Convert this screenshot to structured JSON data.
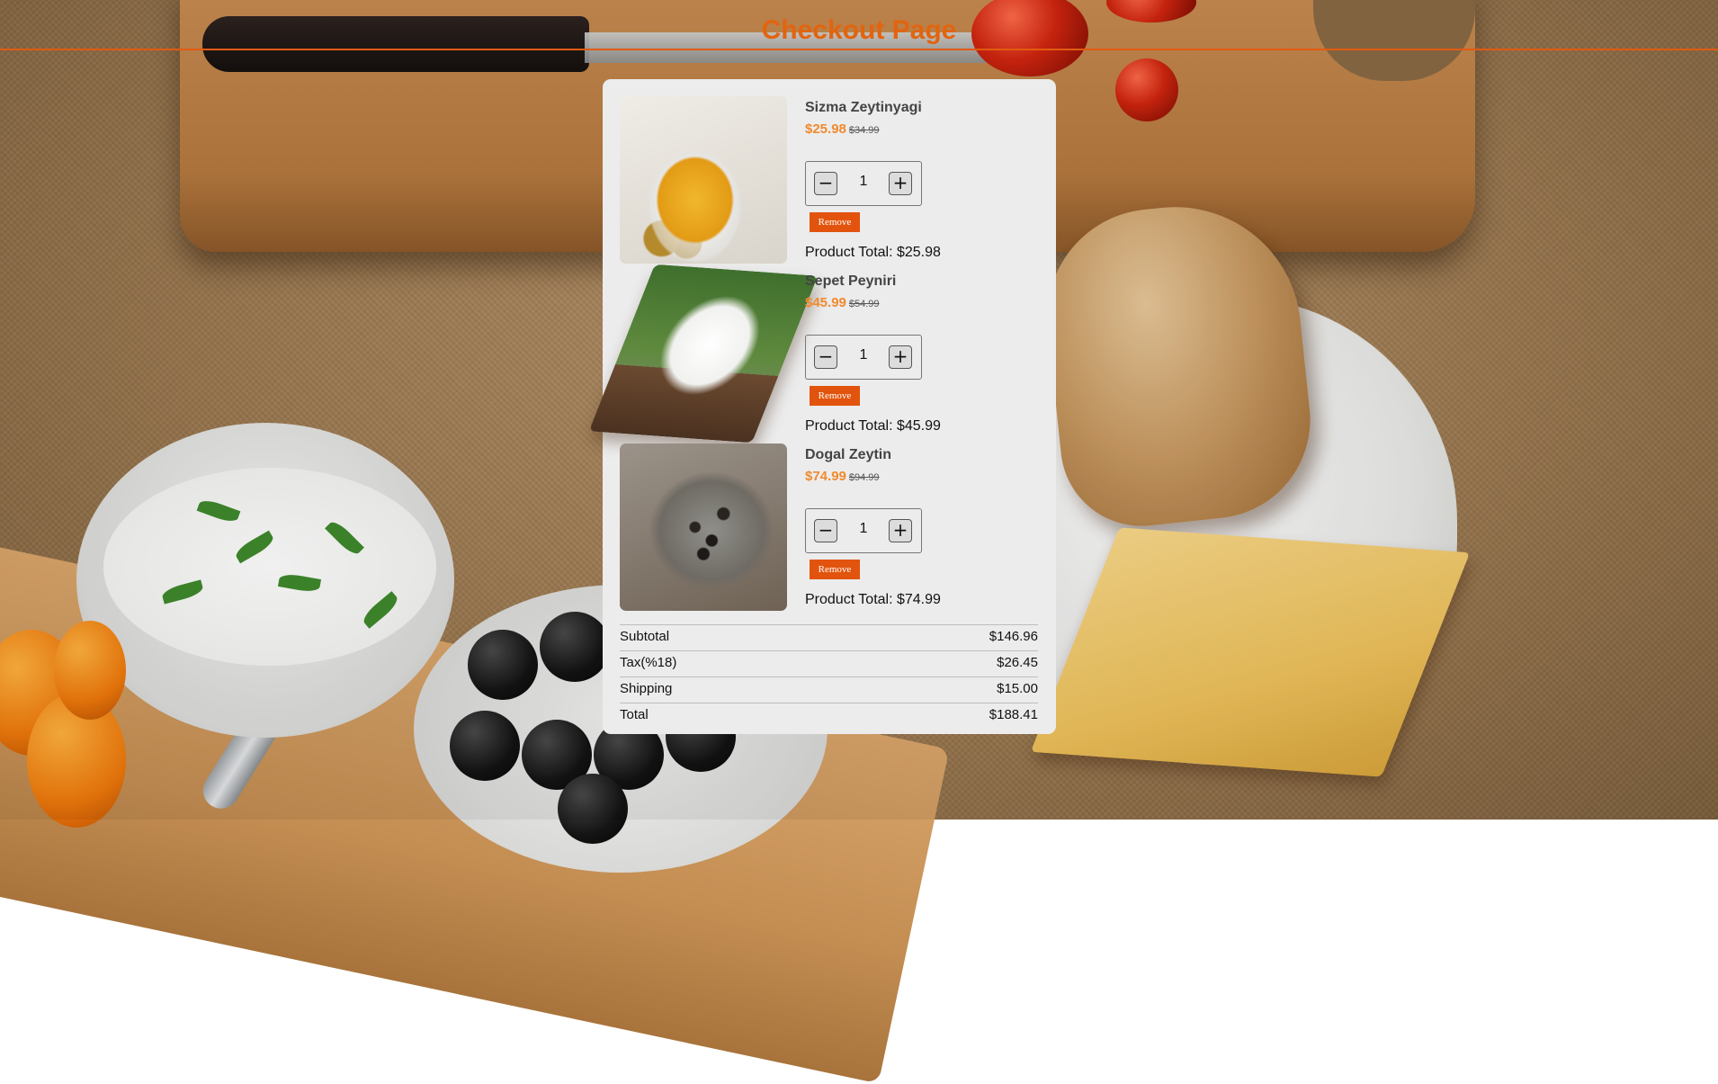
{
  "header": {
    "title": "Checkout Page"
  },
  "colors": {
    "accent": "#e2640f",
    "price": "#f08a2e",
    "remove": "#e2540d",
    "card": "#ececec"
  },
  "items": [
    {
      "name": "Sizma Zeytinyagi",
      "price": "$25.98",
      "old_price": "$34.99",
      "quantity": "1",
      "remove_label": "Remove",
      "total_text": "Product Total: $25.98",
      "image_icon": "olive-oil-photo"
    },
    {
      "name": "Sepet Peyniri",
      "price": "$45.99",
      "old_price": "$54.99",
      "quantity": "1",
      "remove_label": "Remove",
      "total_text": "Product Total: $45.99",
      "image_icon": "cheese-photo"
    },
    {
      "name": "Dogal Zeytin",
      "price": "$74.99",
      "old_price": "$94.99",
      "quantity": "1",
      "remove_label": "Remove",
      "total_text": "Product Total: $74.99",
      "image_icon": "olives-photo"
    }
  ],
  "buttons": {
    "minus": "−",
    "plus": "+"
  },
  "summary": {
    "subtotal_label": "Subtotal",
    "subtotal": "$146.96",
    "tax_label": "Tax(%18)",
    "tax": "$26.45",
    "shipping_label": "Shipping",
    "shipping": "$15.00",
    "total_label": "Total",
    "total": "$188.41"
  }
}
